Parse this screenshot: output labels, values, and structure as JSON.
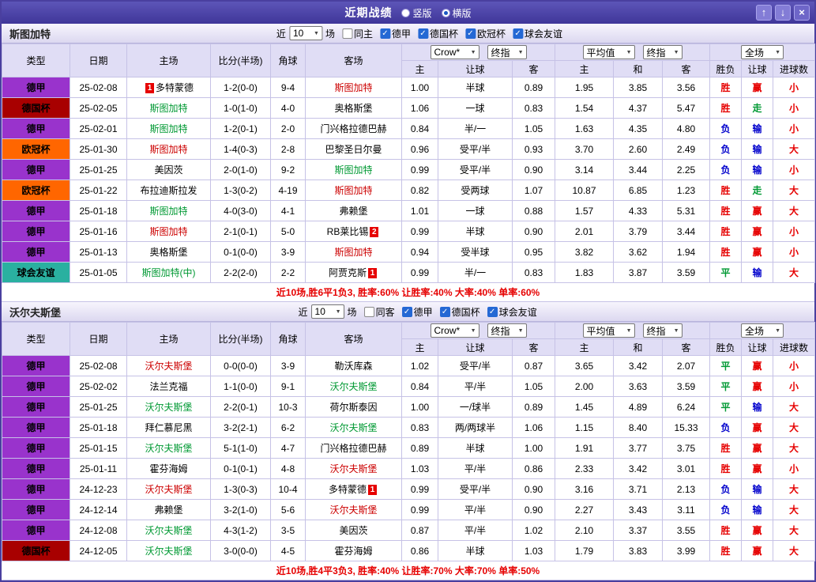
{
  "titlebar": {
    "title": "近期战绩",
    "radios": [
      {
        "label": "竖版",
        "selected": false
      },
      {
        "label": "横版",
        "selected": true
      }
    ]
  },
  "icons": {
    "chevron_down": "▼",
    "arrow_up": "↑",
    "arrow_down": "↓",
    "close": "×"
  },
  "filter": {
    "near_label": "近",
    "count": "10",
    "games_label": "场"
  },
  "headers": {
    "type": "类型",
    "date": "日期",
    "home": "主场",
    "score": "比分(半场)",
    "corner": "角球",
    "away": "客场",
    "asian_home": "主",
    "asian_handicap": "让球",
    "asian_away": "客",
    "euro_home": "主",
    "euro_draw": "和",
    "euro_away": "客",
    "res_wdl": "胜负",
    "res_handicap": "让球",
    "res_goals": "进球数",
    "sel_provider": "Crow*",
    "sel_final1": "终指",
    "sel_avg": "平均值",
    "sel_final2": "终指",
    "sel_scope": "全场"
  },
  "league_colors": {
    "德甲": "#9933cc",
    "德国杯": "#a80000",
    "欧冠杯": "#ff6600",
    "球会友谊": "#2ab0a0"
  },
  "name_colors": {
    "red": "#cc0000",
    "green": "#009933",
    "black": "#000000"
  },
  "result_colors": {
    "胜": "#e60000",
    "平": "#009933",
    "负": "#0000cc",
    "赢": "#e60000",
    "走": "#009933",
    "输": "#0000cc",
    "大": "#e60000",
    "小": "#e60000"
  },
  "sections": [
    {
      "team": "斯图加特",
      "same_label": "同主",
      "same_checked": false,
      "leagues": [
        {
          "label": "德甲",
          "checked": true
        },
        {
          "label": "德国杯",
          "checked": true
        },
        {
          "label": "欧冠杯",
          "checked": true
        },
        {
          "label": "球会友谊",
          "checked": true
        }
      ],
      "rows": [
        {
          "league": "德甲",
          "date": "25-02-08",
          "home": "多特蒙德",
          "home_color": "black",
          "home_badge": "1",
          "home_badge_side": "left",
          "score": "1-2(0-0)",
          "corner": "9-4",
          "away": "斯图加特",
          "away_color": "red",
          "ah": "1.00",
          "handicap": "半球",
          "aa": "0.89",
          "eh": "1.95",
          "ed": "3.85",
          "ea": "3.56",
          "r1": "胜",
          "r2": "赢",
          "r3": "小"
        },
        {
          "league": "德国杯",
          "date": "25-02-05",
          "home": "斯图加特",
          "home_color": "green",
          "score": "1-0(1-0)",
          "corner": "4-0",
          "away": "奥格斯堡",
          "away_color": "black",
          "ah": "1.06",
          "handicap": "一球",
          "aa": "0.83",
          "eh": "1.54",
          "ed": "4.37",
          "ea": "5.47",
          "r1": "胜",
          "r2": "走",
          "r3": "小"
        },
        {
          "league": "德甲",
          "date": "25-02-01",
          "home": "斯图加特",
          "home_color": "green",
          "score": "1-2(0-1)",
          "corner": "2-0",
          "away": "门兴格拉德巴赫",
          "away_color": "black",
          "ah": "0.84",
          "handicap": "半/一",
          "aa": "1.05",
          "eh": "1.63",
          "ed": "4.35",
          "ea": "4.80",
          "r1": "负",
          "r2": "输",
          "r3": "小"
        },
        {
          "league": "欧冠杯",
          "date": "25-01-30",
          "home": "斯图加特",
          "home_color": "red",
          "score": "1-4(0-3)",
          "corner": "2-8",
          "away": "巴黎圣日尔曼",
          "away_color": "black",
          "ah": "0.96",
          "handicap": "受平/半",
          "aa": "0.93",
          "eh": "3.70",
          "ed": "2.60",
          "ea": "2.49",
          "r1": "负",
          "r2": "输",
          "r3": "大"
        },
        {
          "league": "德甲",
          "date": "25-01-25",
          "home": "美因茨",
          "home_color": "black",
          "score": "2-0(1-0)",
          "corner": "9-2",
          "away": "斯图加特",
          "away_color": "green",
          "ah": "0.99",
          "handicap": "受平/半",
          "aa": "0.90",
          "eh": "3.14",
          "ed": "3.44",
          "ea": "2.25",
          "r1": "负",
          "r2": "输",
          "r3": "小"
        },
        {
          "league": "欧冠杯",
          "date": "25-01-22",
          "home": "布拉迪斯拉发",
          "home_color": "black",
          "score": "1-3(0-2)",
          "corner": "4-19",
          "away": "斯图加特",
          "away_color": "red",
          "ah": "0.82",
          "handicap": "受两球",
          "aa": "1.07",
          "eh": "10.87",
          "ed": "6.85",
          "ea": "1.23",
          "r1": "胜",
          "r2": "走",
          "r3": "大"
        },
        {
          "league": "德甲",
          "date": "25-01-18",
          "home": "斯图加特",
          "home_color": "green",
          "score": "4-0(3-0)",
          "corner": "4-1",
          "away": "弗赖堡",
          "away_color": "black",
          "ah": "1.01",
          "handicap": "一球",
          "aa": "0.88",
          "eh": "1.57",
          "ed": "4.33",
          "ea": "5.31",
          "r1": "胜",
          "r2": "赢",
          "r3": "大"
        },
        {
          "league": "德甲",
          "date": "25-01-16",
          "home": "斯图加特",
          "home_color": "red",
          "score": "2-1(0-1)",
          "corner": "5-0",
          "away": "RB莱比锡",
          "away_color": "black",
          "away_badge": "2",
          "ah": "0.99",
          "handicap": "半球",
          "aa": "0.90",
          "eh": "2.01",
          "ed": "3.79",
          "ea": "3.44",
          "r1": "胜",
          "r2": "赢",
          "r3": "小"
        },
        {
          "league": "德甲",
          "date": "25-01-13",
          "home": "奥格斯堡",
          "home_color": "black",
          "score": "0-1(0-0)",
          "corner": "3-9",
          "away": "斯图加特",
          "away_color": "red",
          "ah": "0.94",
          "handicap": "受半球",
          "aa": "0.95",
          "eh": "3.82",
          "ed": "3.62",
          "ea": "1.94",
          "r1": "胜",
          "r2": "赢",
          "r3": "小"
        },
        {
          "league": "球会友谊",
          "date": "25-01-05",
          "home": "斯图加特(中)",
          "home_color": "green",
          "score": "2-2(2-0)",
          "corner": "2-2",
          "away": "阿贾克斯",
          "away_color": "black",
          "away_badge": "1",
          "ah": "0.99",
          "handicap": "半/一",
          "aa": "0.83",
          "eh": "1.83",
          "ed": "3.87",
          "ea": "3.59",
          "r1": "平",
          "r2": "输",
          "r3": "大"
        }
      ],
      "summary": "近10场,胜6平1负3, 胜率:60% 让胜率:40% 大率:40% 单率:60%"
    },
    {
      "team": "沃尔夫斯堡",
      "same_label": "同客",
      "same_checked": false,
      "leagues": [
        {
          "label": "德甲",
          "checked": true
        },
        {
          "label": "德国杯",
          "checked": true
        },
        {
          "label": "球会友谊",
          "checked": true
        }
      ],
      "rows": [
        {
          "league": "德甲",
          "date": "25-02-08",
          "home": "沃尔夫斯堡",
          "home_color": "red",
          "score": "0-0(0-0)",
          "corner": "3-9",
          "away": "勒沃库森",
          "away_color": "black",
          "ah": "1.02",
          "handicap": "受平/半",
          "aa": "0.87",
          "eh": "3.65",
          "ed": "3.42",
          "ea": "2.07",
          "r1": "平",
          "r2": "赢",
          "r3": "小"
        },
        {
          "league": "德甲",
          "date": "25-02-02",
          "home": "法兰克福",
          "home_color": "black",
          "score": "1-1(0-0)",
          "corner": "9-1",
          "away": "沃尔夫斯堡",
          "away_color": "green",
          "ah": "0.84",
          "handicap": "平/半",
          "aa": "1.05",
          "eh": "2.00",
          "ed": "3.63",
          "ea": "3.59",
          "r1": "平",
          "r2": "赢",
          "r3": "小"
        },
        {
          "league": "德甲",
          "date": "25-01-25",
          "home": "沃尔夫斯堡",
          "home_color": "green",
          "score": "2-2(0-1)",
          "corner": "10-3",
          "away": "荷尔斯泰因",
          "away_color": "black",
          "ah": "1.00",
          "handicap": "一/球半",
          "aa": "0.89",
          "eh": "1.45",
          "ed": "4.89",
          "ea": "6.24",
          "r1": "平",
          "r2": "输",
          "r3": "大"
        },
        {
          "league": "德甲",
          "date": "25-01-18",
          "home": "拜仁慕尼黑",
          "home_color": "black",
          "score": "3-2(2-1)",
          "corner": "6-2",
          "away": "沃尔夫斯堡",
          "away_color": "green",
          "ah": "0.83",
          "handicap": "两/两球半",
          "aa": "1.06",
          "eh": "1.15",
          "ed": "8.40",
          "ea": "15.33",
          "r1": "负",
          "r2": "赢",
          "r3": "大"
        },
        {
          "league": "德甲",
          "date": "25-01-15",
          "home": "沃尔夫斯堡",
          "home_color": "green",
          "score": "5-1(1-0)",
          "corner": "4-7",
          "away": "门兴格拉德巴赫",
          "away_color": "black",
          "ah": "0.89",
          "handicap": "半球",
          "aa": "1.00",
          "eh": "1.91",
          "ed": "3.77",
          "ea": "3.75",
          "r1": "胜",
          "r2": "赢",
          "r3": "大"
        },
        {
          "league": "德甲",
          "date": "25-01-11",
          "home": "霍芬海姆",
          "home_color": "black",
          "score": "0-1(0-1)",
          "corner": "4-8",
          "away": "沃尔夫斯堡",
          "away_color": "red",
          "ah": "1.03",
          "handicap": "平/半",
          "aa": "0.86",
          "eh": "2.33",
          "ed": "3.42",
          "ea": "3.01",
          "r1": "胜",
          "r2": "赢",
          "r3": "小"
        },
        {
          "league": "德甲",
          "date": "24-12-23",
          "home": "沃尔夫斯堡",
          "home_color": "red",
          "score": "1-3(0-3)",
          "corner": "10-4",
          "away": "多特蒙德",
          "away_color": "black",
          "away_badge": "1",
          "ah": "0.99",
          "handicap": "受平/半",
          "aa": "0.90",
          "eh": "3.16",
          "ed": "3.71",
          "ea": "2.13",
          "r1": "负",
          "r2": "输",
          "r3": "大"
        },
        {
          "league": "德甲",
          "date": "24-12-14",
          "home": "弗赖堡",
          "home_color": "black",
          "score": "3-2(1-0)",
          "corner": "5-6",
          "away": "沃尔夫斯堡",
          "away_color": "red",
          "ah": "0.99",
          "handicap": "平/半",
          "aa": "0.90",
          "eh": "2.27",
          "ed": "3.43",
          "ea": "3.11",
          "r1": "负",
          "r2": "输",
          "r3": "大"
        },
        {
          "league": "德甲",
          "date": "24-12-08",
          "home": "沃尔夫斯堡",
          "home_color": "green",
          "score": "4-3(1-2)",
          "corner": "3-5",
          "away": "美因茨",
          "away_color": "black",
          "ah": "0.87",
          "handicap": "平/半",
          "aa": "1.02",
          "eh": "2.10",
          "ed": "3.37",
          "ea": "3.55",
          "r1": "胜",
          "r2": "赢",
          "r3": "大"
        },
        {
          "league": "德国杯",
          "date": "24-12-05",
          "home": "沃尔夫斯堡",
          "home_color": "green",
          "score": "3-0(0-0)",
          "corner": "4-5",
          "away": "霍芬海姆",
          "away_color": "black",
          "ah": "0.86",
          "handicap": "半球",
          "aa": "1.03",
          "eh": "1.79",
          "ed": "3.83",
          "ea": "3.99",
          "r1": "胜",
          "r2": "赢",
          "r3": "大"
        }
      ],
      "summary": "近10场,胜4平3负3, 胜率:40% 让胜率:70% 大率:70% 单率:50%"
    }
  ]
}
